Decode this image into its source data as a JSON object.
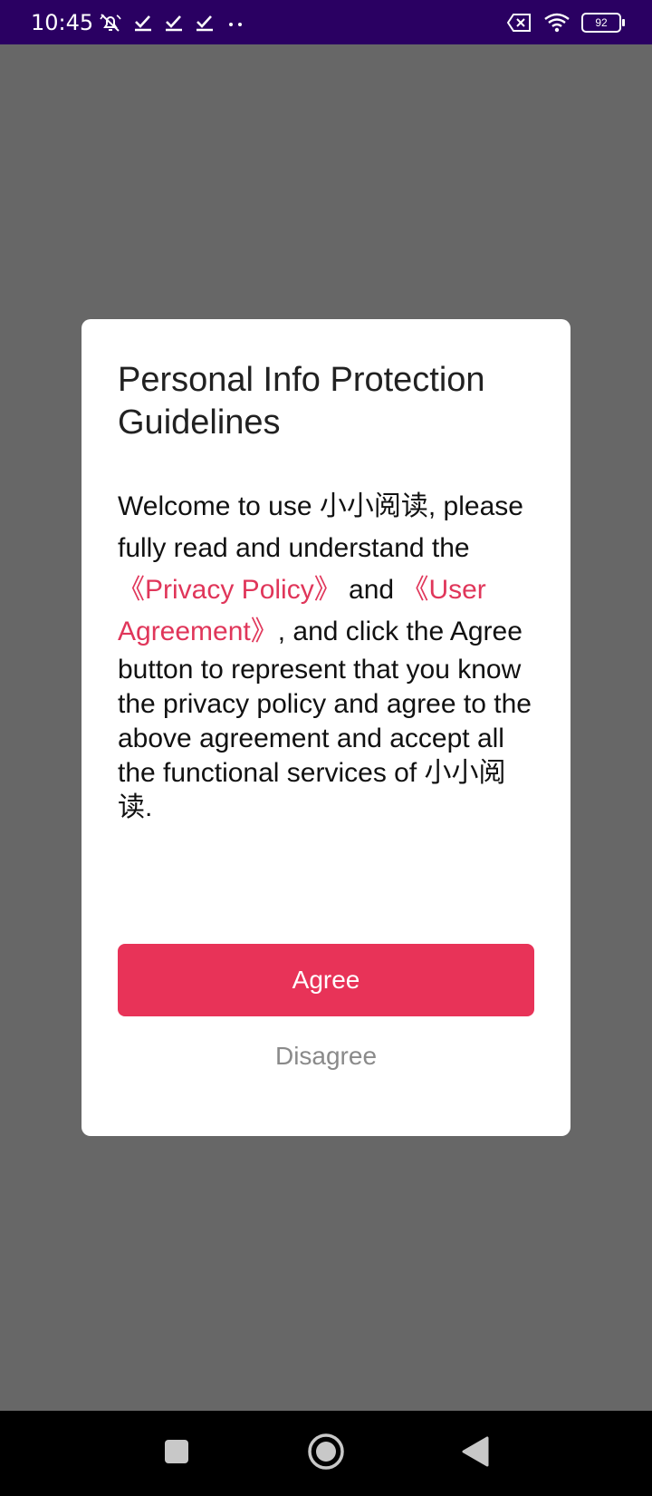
{
  "status_bar": {
    "time": "10:45",
    "left_icons": [
      "mute-icon",
      "check-icon",
      "check-icon",
      "check-icon",
      "more-dots-icon"
    ],
    "right_icons": [
      "sim-off-icon",
      "wifi-icon",
      "battery-icon"
    ],
    "battery_level": "92"
  },
  "dialog": {
    "title": "Personal Info Protection Guidelines",
    "body": {
      "intro": "Welcome to use 小小阅读, please fully read and understand the ",
      "privacy_link": "《Privacy Policy》",
      "and_text": " and ",
      "agreement_link": "《User Agreement》",
      "outro": ", and click the Agree button to represent that you know the privacy policy and agree to the above agreement and accept all the functional services of 小小阅读."
    },
    "agree_label": "Agree",
    "disagree_label": "Disagree"
  },
  "colors": {
    "status_bar_bg": "#2a0062",
    "overlay_bg": "#676767",
    "accent": "#e83358",
    "link": "#e0365a",
    "disagree_text": "#8a8a8a"
  },
  "nav_bar": {
    "icons": [
      "recents-square-icon",
      "home-circle-icon",
      "back-triangle-icon"
    ]
  }
}
